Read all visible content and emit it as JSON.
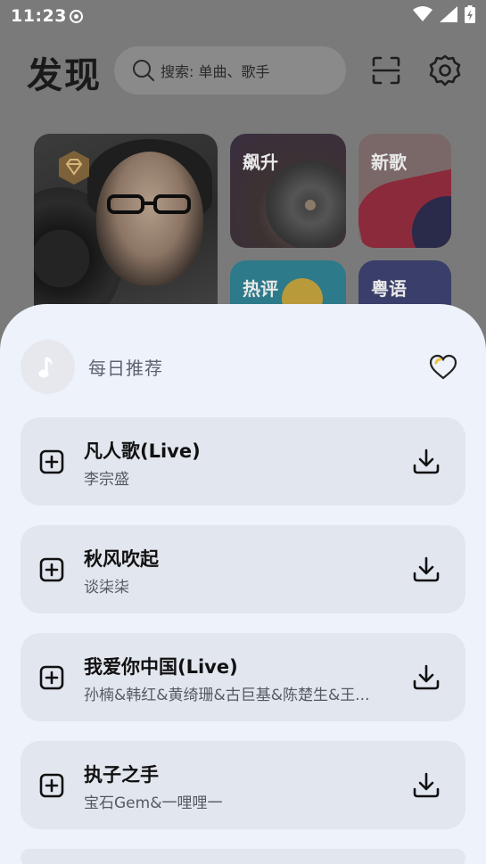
{
  "status": {
    "time": "11:23"
  },
  "header": {
    "title": "发现",
    "search_placeholder": "搜索: 单曲、歌手"
  },
  "cards": {
    "soaring": "飙升",
    "new_songs": "新歌",
    "hot_comments": "热评",
    "cantonese": "粤语"
  },
  "sheet": {
    "title": "每日推荐",
    "songs": [
      {
        "title": "凡人歌(Live)",
        "artist": "李宗盛"
      },
      {
        "title": "秋风吹起",
        "artist": "谈柒柒"
      },
      {
        "title": "我爱你中国(Live)",
        "artist": "孙楠&韩红&黄绮珊&古巨基&陈楚生&王..."
      },
      {
        "title": "执子之手",
        "artist": "宝石Gem&一哩哩一"
      }
    ]
  },
  "colors": {
    "sheet_bg": "#eef3fb",
    "song_bg": "#e2e6ee",
    "dim_bg": "#7a7a7a"
  }
}
